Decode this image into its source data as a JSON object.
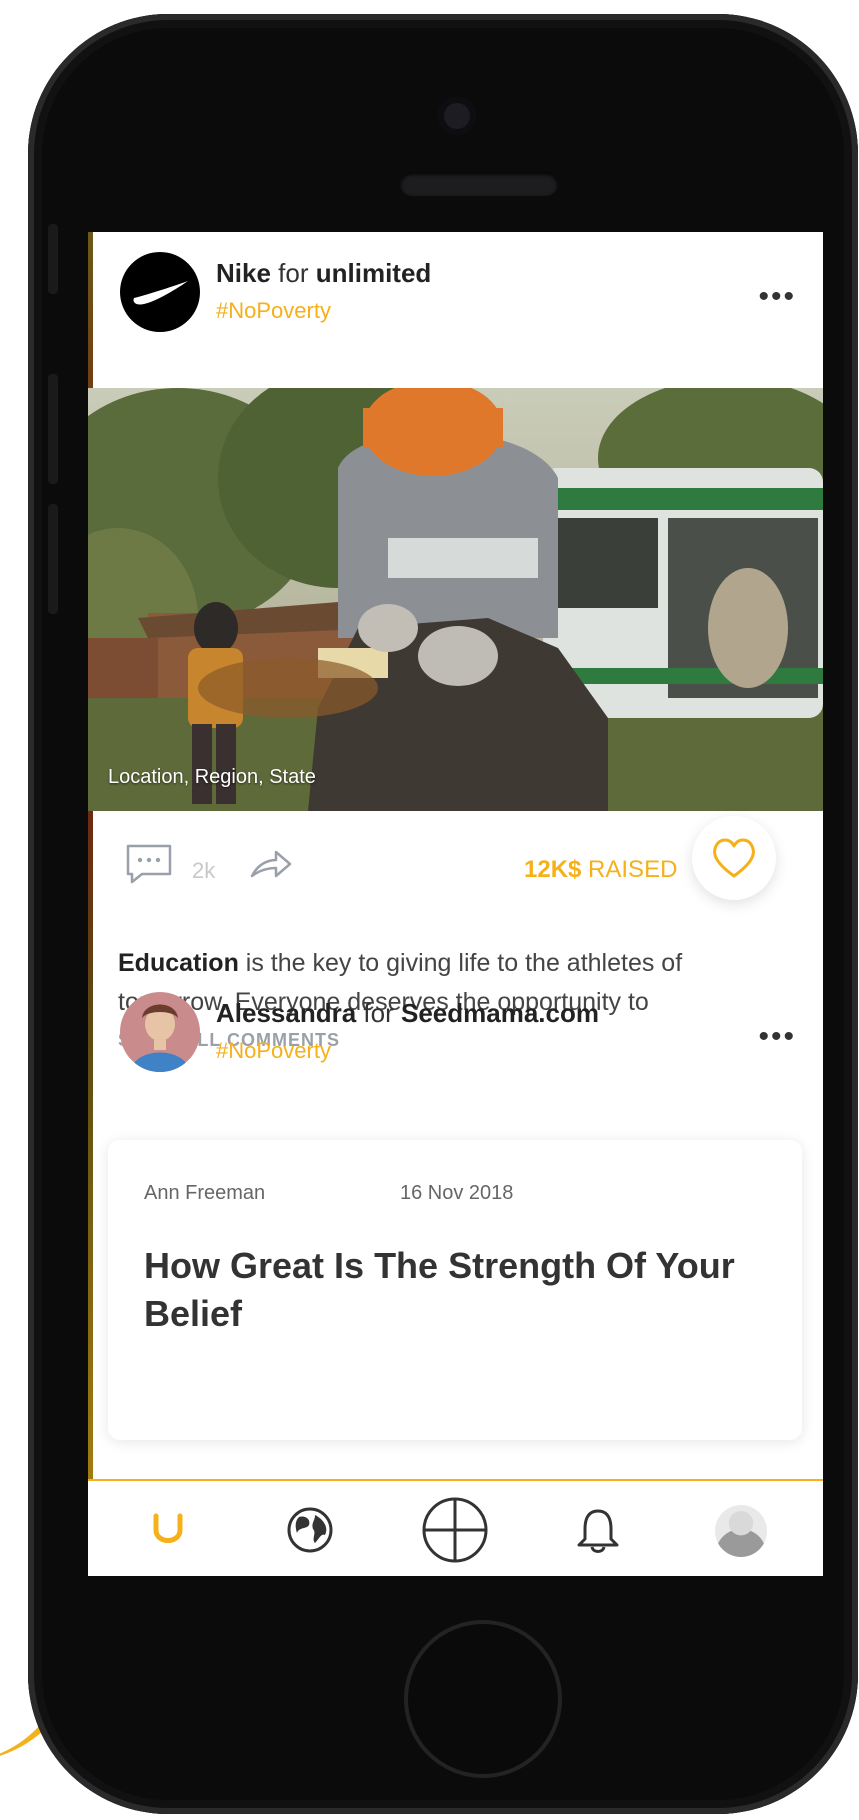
{
  "colors": {
    "accent": "#F5B01A",
    "text_dark": "#222222",
    "text_muted": "#9aa0aa"
  },
  "post1": {
    "author": "Nike",
    "for_word": "for",
    "organization": "unlimited",
    "hashtag": "#NoPoverty",
    "more_icon": "more-dots-icon",
    "location": "Location, Region, State",
    "comment_count": "2k",
    "raised_amount": "12K$",
    "raised_label": "RAISED",
    "caption_bold": "Education",
    "caption_rest": " is the key to giving life to the athletes of tomorrow. Everyone deserves the opportunity to",
    "show_comments": "SHOW ALL COMMENTS"
  },
  "post2": {
    "author": "Alessandra",
    "for_word": "for",
    "organization": "Seedmama.com",
    "hashtag": "#NoPoverty",
    "article": {
      "author": "Ann Freeman",
      "date": "16 Nov 2018",
      "title": "How Great Is The Strength Of Your Belief"
    }
  },
  "nav": {
    "items": [
      {
        "name": "home",
        "icon": "unlimited-logo-icon",
        "active": true
      },
      {
        "name": "explore",
        "icon": "globe-icon"
      },
      {
        "name": "create",
        "icon": "plus-circle-icon"
      },
      {
        "name": "notifications",
        "icon": "bell-icon"
      },
      {
        "name": "profile",
        "icon": "avatar"
      }
    ]
  }
}
